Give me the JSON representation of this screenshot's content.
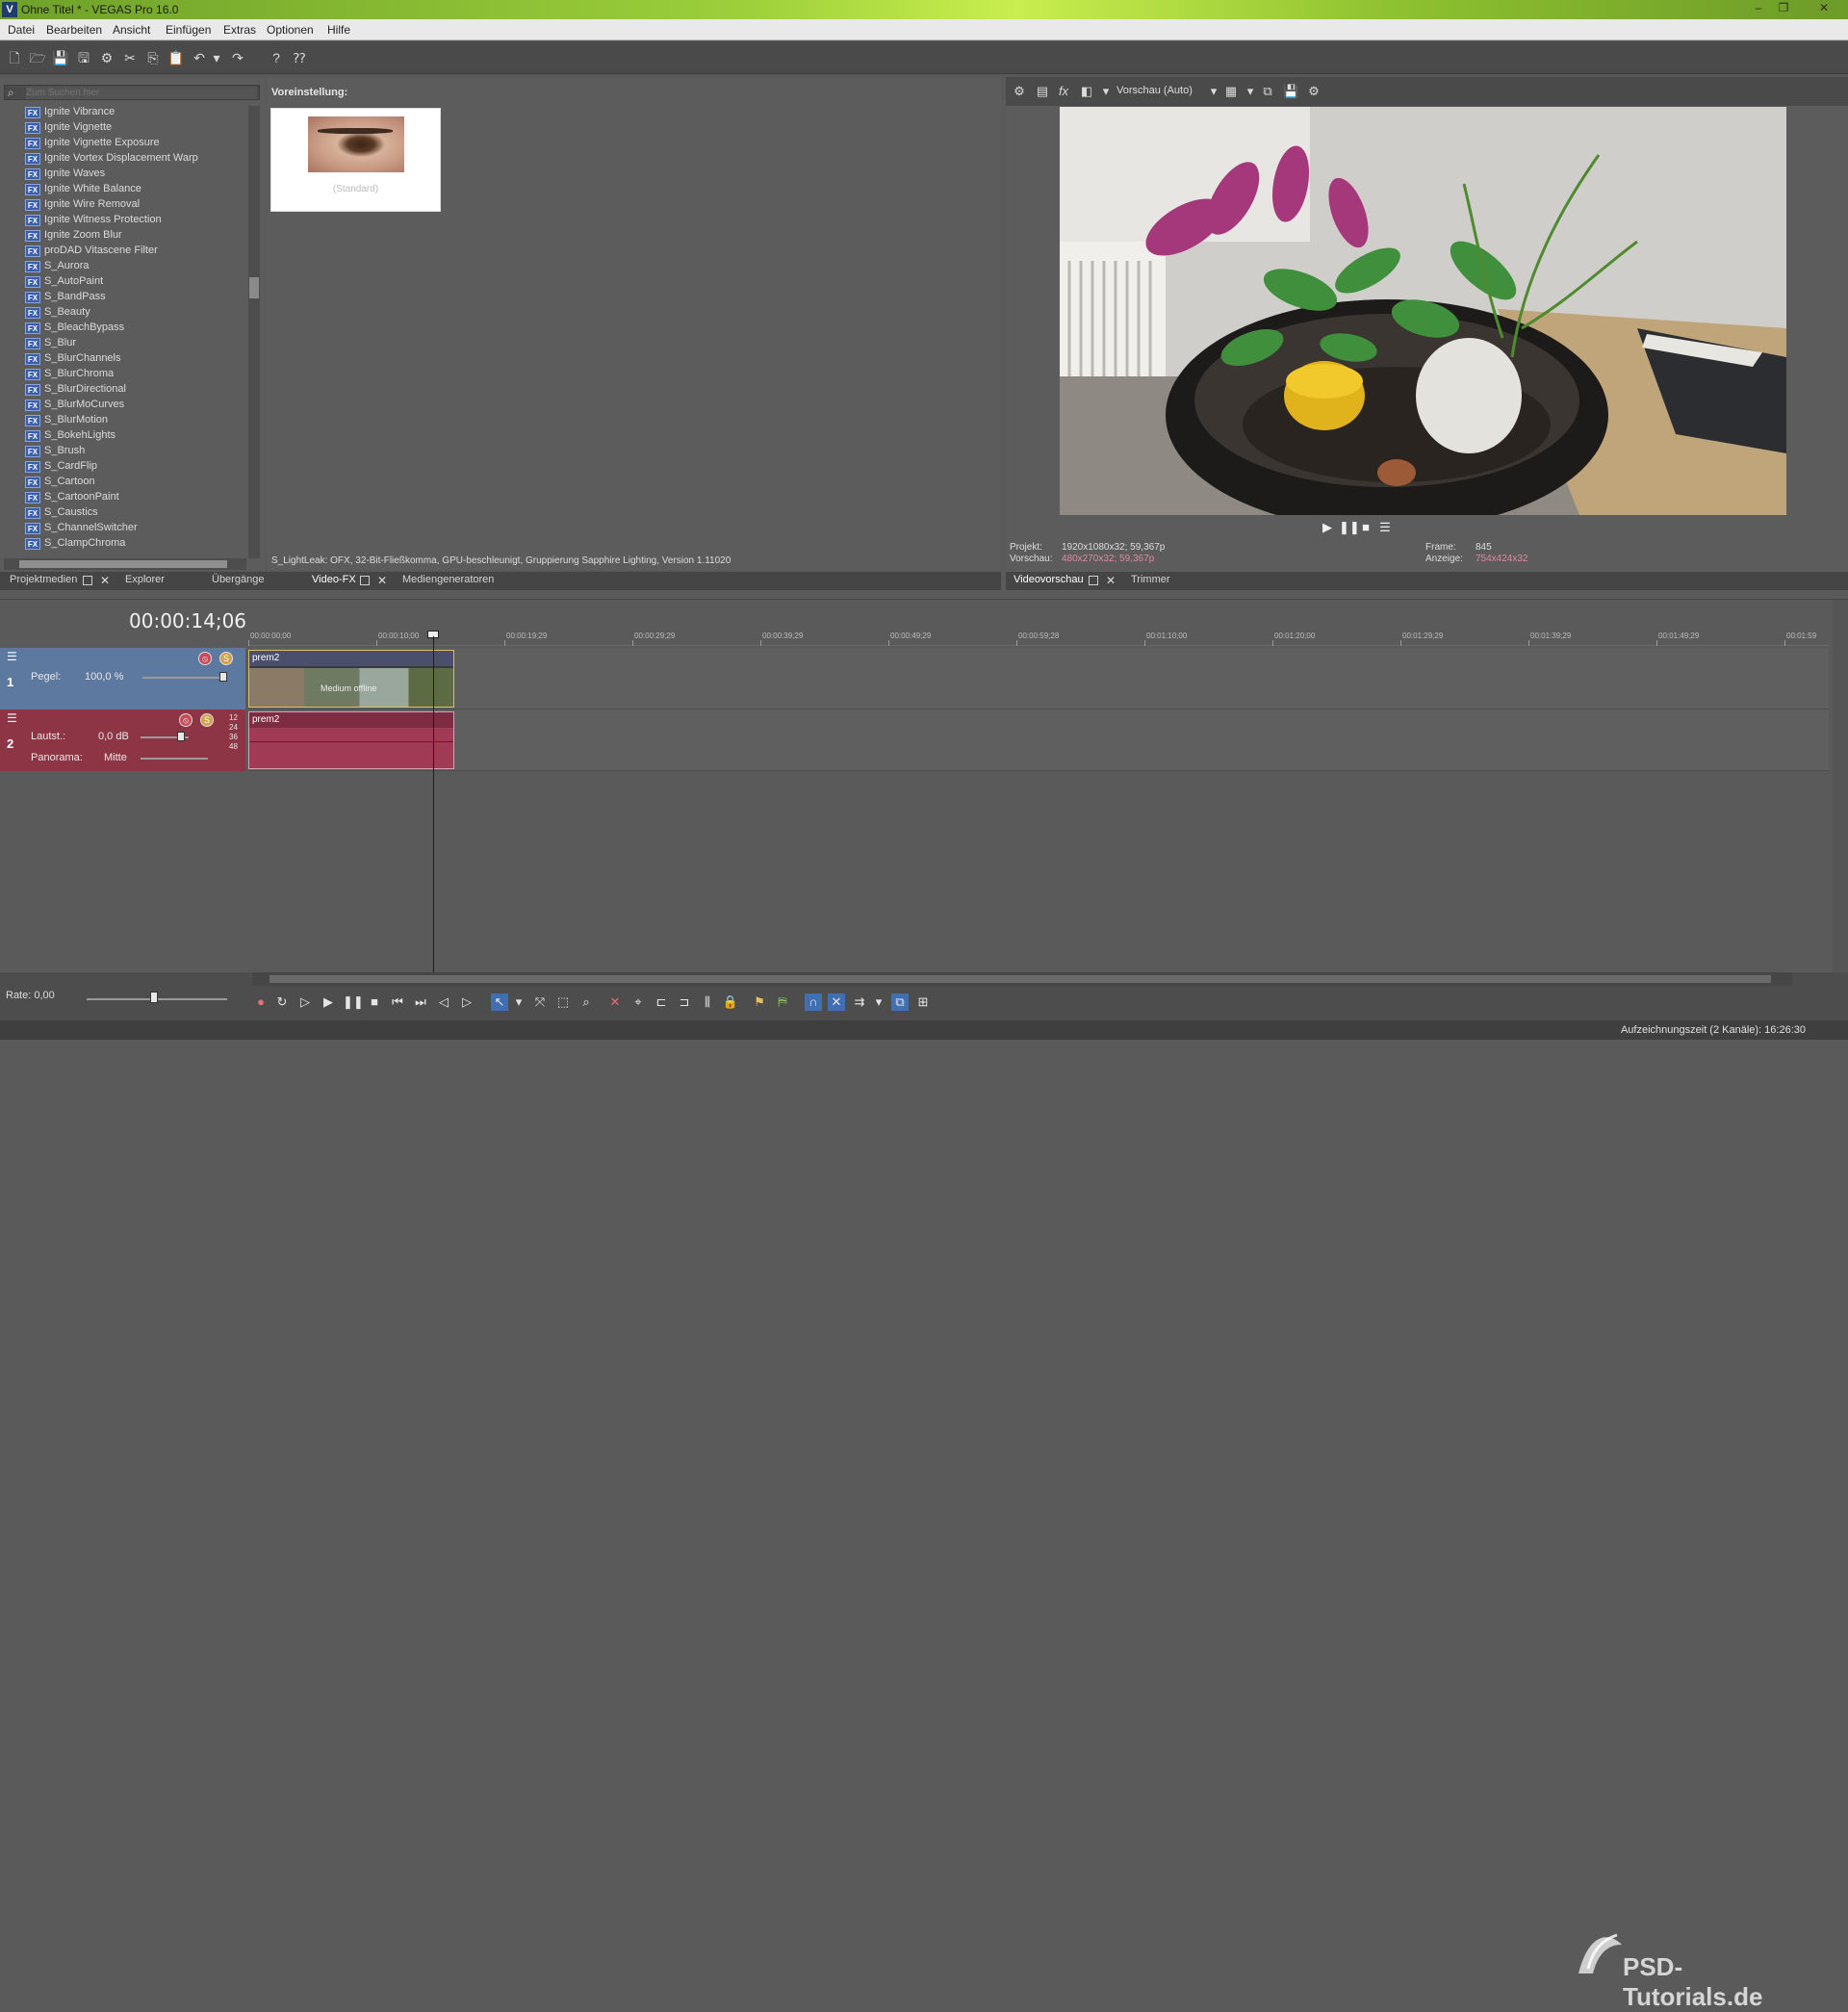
{
  "app": {
    "logo_letter": "V",
    "title": "Ohne Titel * - VEGAS Pro 16.0",
    "window_buttons": [
      "–",
      "❐",
      "✕"
    ]
  },
  "menu": [
    "Datei",
    "Bearbeiten",
    "Ansicht",
    "Einfügen",
    "Extras",
    "Optionen",
    "Hilfe"
  ],
  "fx_panel": {
    "search_placeholder": "Zum Suchen hier",
    "items": [
      "Ignite Vibrance",
      "Ignite Vignette",
      "Ignite Vignette Exposure",
      "Ignite Vortex Displacement Warp",
      "Ignite Waves",
      "Ignite White Balance",
      "Ignite Wire Removal",
      "Ignite Witness Protection",
      "Ignite Zoom Blur",
      "proDAD Vitascene Filter",
      "S_Aurora",
      "S_AutoPaint",
      "S_BandPass",
      "S_Beauty",
      "S_BleachBypass",
      "S_Blur",
      "S_BlurChannels",
      "S_BlurChroma",
      "S_BlurDirectional",
      "S_BlurMoCurves",
      "S_BlurMotion",
      "S_BokehLights",
      "S_Brush",
      "S_CardFlip",
      "S_Cartoon",
      "S_CartoonPaint",
      "S_Caustics",
      "S_ChannelSwitcher",
      "S_ClampChroma"
    ],
    "badge": "FX"
  },
  "preset_panel": {
    "label": "Voreinstellung:",
    "preset_caption": "(Standard)",
    "info": "S_LightLeak: OFX, 32-Bit-Fließkomma, GPU-beschleunigt, Gruppierung  Sapphire Lighting, Version 1.11020"
  },
  "left_tabs": [
    "Projektmedien",
    "Explorer",
    "Übergänge",
    "Video-FX",
    "Mediengeneratoren"
  ],
  "preview": {
    "mode": "Vorschau (Auto)",
    "projekt_label": "Projekt:",
    "projekt_value": "1920x1080x32; 59,367p",
    "vorschau_label": "Vorschau:",
    "vorschau_value": "480x270x32; 59,367p",
    "frame_label": "Frame:",
    "frame_value": "845",
    "anzeige_label": "Anzeige:",
    "anzeige_value": "754x424x32",
    "tabs": [
      "Videovorschau",
      "Trimmer"
    ]
  },
  "timeline": {
    "timecode": "00:00:14;06",
    "ruler": [
      "00:00:00;00",
      "00:00:10;00",
      "00:00:19;29",
      "00:00:29;29",
      "00:00:39;29",
      "00:00:49;29",
      "00:00:59;28",
      "00:01:10;00",
      "00:01:20;00",
      "00:01:29;29",
      "00:01:39;29",
      "00:01:49;29",
      "00:01:59"
    ],
    "track1": {
      "number": "1",
      "pegel_label": "Pegel:",
      "pegel_value": "100,0 %",
      "clip_name": "prem2",
      "offline_text": "Medium offline"
    },
    "track2": {
      "number": "2",
      "volume_label": "Lautst.:",
      "volume_value": "0,0 dB",
      "pan_label": "Panorama:",
      "pan_value": "Mitte",
      "clip_name": "prem2",
      "db_scale": [
        "12",
        "24",
        "36",
        "48"
      ]
    }
  },
  "bottom": {
    "rate_label": "Rate: 0,00"
  },
  "status": {
    "text": "Aufzeichnungszeit (2 Kanäle): 16:26:30"
  },
  "watermark": "PSD-Tutorials.de"
}
